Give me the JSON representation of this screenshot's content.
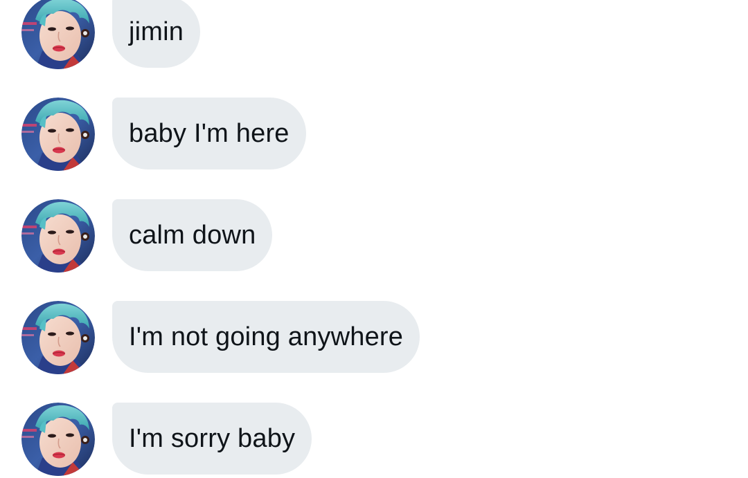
{
  "conversation": {
    "avatar_icon": "profile-photo-avatar",
    "bubble_color": "#e8ecef",
    "text_color": "#0f1419",
    "messages": [
      {
        "text": "jimin"
      },
      {
        "text": "baby I'm here"
      },
      {
        "text": "calm down"
      },
      {
        "text": "I'm not going anywhere"
      },
      {
        "text": "I'm sorry baby"
      }
    ]
  }
}
